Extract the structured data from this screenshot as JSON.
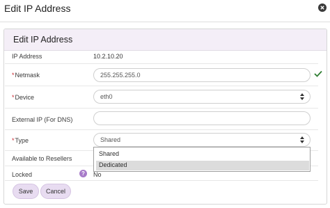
{
  "window": {
    "title": "Edit IP Address",
    "close_icon": "close-icon"
  },
  "panel": {
    "title": "Edit IP Address"
  },
  "form": {
    "ip_address": {
      "label": "IP Address",
      "value": "10.2.10.20"
    },
    "netmask": {
      "label": "Netmask",
      "required": "*",
      "value": "255.255.255.0",
      "status_icon": "check-icon",
      "status_color": "#2e7d32"
    },
    "device": {
      "label": "Device",
      "required": "*",
      "value": "eth0"
    },
    "external_ip": {
      "label": "External IP (For DNS)",
      "value": ""
    },
    "type": {
      "label": "Type",
      "required": "*",
      "value": "Shared",
      "options": [
        "Shared",
        "Dedicated"
      ],
      "highlighted_option": "Dedicated"
    },
    "available_to_resellers": {
      "label": "Available to Resellers"
    },
    "locked": {
      "label": "Locked",
      "help_icon": "?",
      "value": "No"
    }
  },
  "buttons": {
    "save": "Save",
    "cancel": "Cancel"
  },
  "colors": {
    "accent": "#e8dcf1",
    "header_bg": "#f4eef7",
    "required": "#c8282f",
    "help": "#a77bc9"
  }
}
